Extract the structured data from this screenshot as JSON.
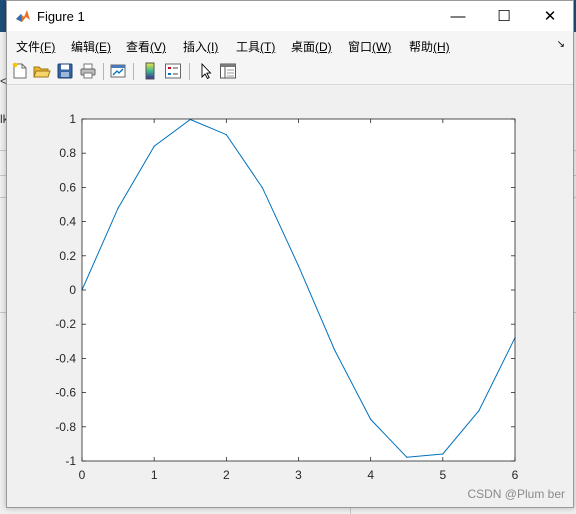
{
  "window": {
    "title": "Figure 1",
    "minimize_glyph": "—",
    "maximize_glyph": "☐",
    "close_glyph": "✕"
  },
  "menu": {
    "items": [
      {
        "label": "文件",
        "mnemonic": "(F)"
      },
      {
        "label": "编辑",
        "mnemonic": "(E)"
      },
      {
        "label": "查看",
        "mnemonic": "(V)"
      },
      {
        "label": "插入",
        "mnemonic": "(I)"
      },
      {
        "label": "工具",
        "mnemonic": "(T)"
      },
      {
        "label": "桌面",
        "mnemonic": "(D)"
      },
      {
        "label": "窗口",
        "mnemonic": "(W)"
      },
      {
        "label": "帮助",
        "mnemonic": "(H)"
      }
    ],
    "overflow_glyph": "↘"
  },
  "toolbar": {
    "icons": [
      "new-figure-icon",
      "open-file-icon",
      "save-icon",
      "print-icon",
      "link-plot-icon",
      "colorbar-icon",
      "legend-icon",
      "edit-plot-arrow-icon",
      "property-inspector-icon"
    ]
  },
  "background": {
    "glyph1": "<",
    "glyph2": "lk"
  },
  "watermark": "CSDN @Plum ber",
  "colors": {
    "line": "#0072bd",
    "axes_bg": "#ffffff",
    "figure_bg": "#f0f0f0"
  },
  "chart_data": {
    "type": "line",
    "title": "",
    "xlabel": "",
    "ylabel": "",
    "xlim": [
      0,
      6
    ],
    "ylim": [
      -1,
      1
    ],
    "xticks": [
      "0",
      "1",
      "2",
      "3",
      "4",
      "5",
      "6"
    ],
    "yticks": [
      "1",
      "0.8",
      "0.6",
      "0.4",
      "0.2",
      "0",
      "-0.2",
      "-0.4",
      "-0.6",
      "-0.8",
      "-1"
    ],
    "grid": false,
    "series": [
      {
        "x": [
          0,
          0.5,
          1,
          1.5,
          2,
          2.5,
          3,
          3.5,
          4,
          4.5,
          5,
          5.5,
          6
        ],
        "y": [
          0,
          0.479,
          0.841,
          0.997,
          0.909,
          0.598,
          0.141,
          -0.351,
          -0.757,
          -0.978,
          -0.959,
          -0.706,
          -0.279
        ]
      }
    ]
  }
}
